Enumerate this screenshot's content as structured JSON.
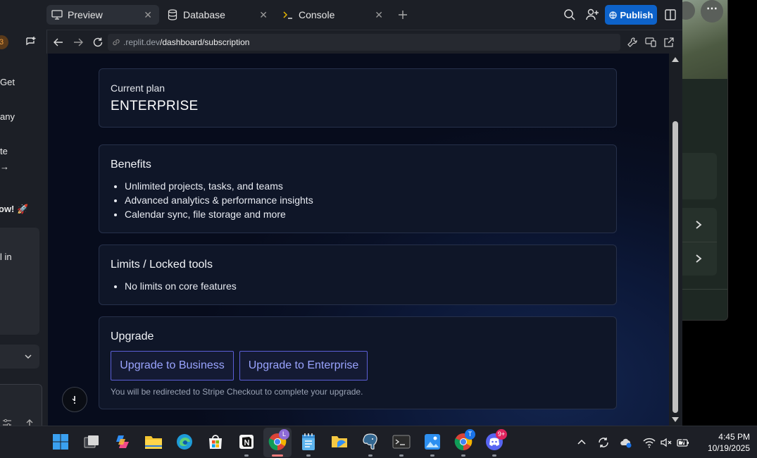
{
  "left_panel": {
    "badge": "3",
    "snippets": [
      "Get",
      "any",
      "te",
      "→",
      "ow! 🚀",
      "l in"
    ]
  },
  "tabs": [
    {
      "label": "Preview",
      "active": true
    },
    {
      "label": "Database",
      "active": false
    },
    {
      "label": "Console",
      "active": false
    }
  ],
  "toolbar": {
    "publish_label": "Publish"
  },
  "address": {
    "host": ".replit.dev",
    "path": "/dashboard/subscription"
  },
  "page": {
    "current_plan": {
      "label": "Current plan",
      "value": "ENTERPRISE"
    },
    "benefits": {
      "title": "Benefits",
      "items": [
        "Unlimited projects, tasks, and teams",
        "Advanced analytics & performance insights",
        "Calendar sync, file storage and more"
      ]
    },
    "limits": {
      "title": "Limits / Locked tools",
      "items": [
        "No limits on core features"
      ]
    },
    "upgrade": {
      "title": "Upgrade",
      "business_label": "Upgrade to Business",
      "enterprise_label": "Upgrade to Enterprise",
      "note": "You will be redirected to Stripe Checkout to complete your upgrade."
    }
  },
  "taskbar": {
    "chrome_badge": "L",
    "chrome2_badge": "T",
    "discord_badge": "9+",
    "time": "4:45 PM",
    "date": "10/19/2025"
  },
  "colors": {
    "publish": "#0d62c9",
    "upgrade_border": "#5b5fd6",
    "upgrade_text": "#9aa4ff"
  }
}
